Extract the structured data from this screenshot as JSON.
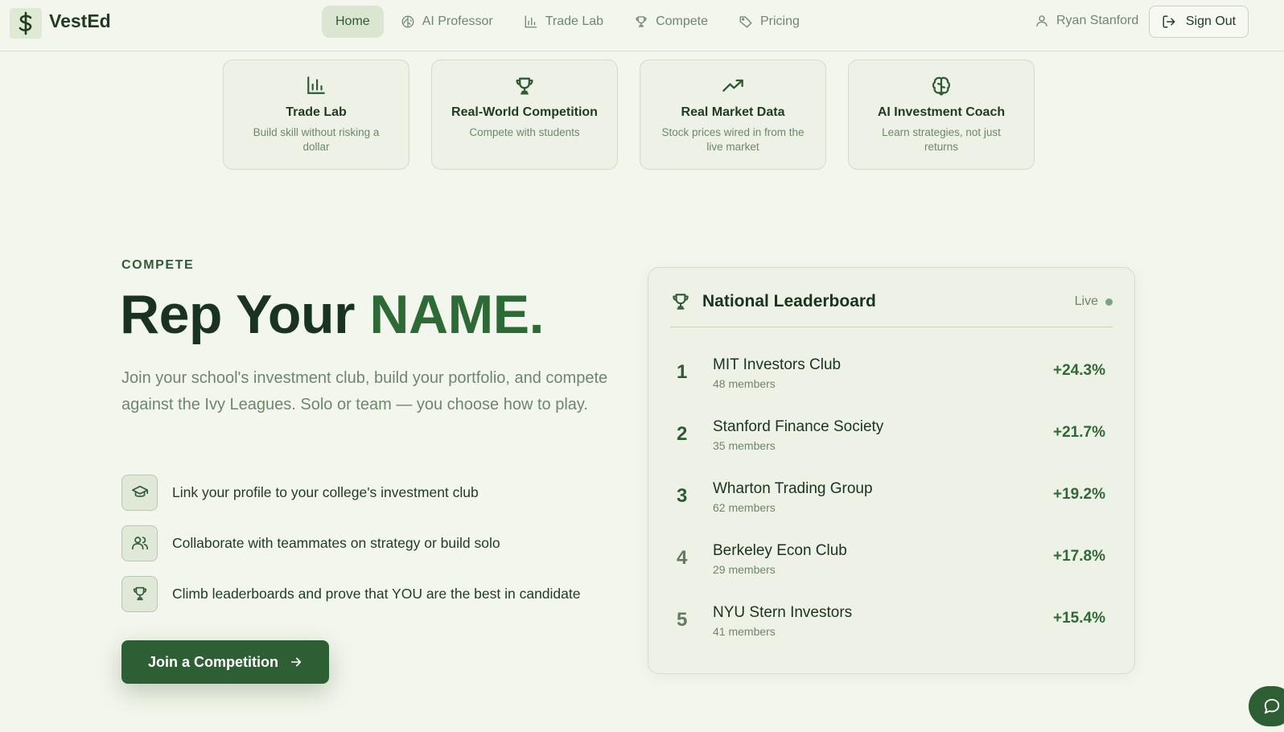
{
  "brand": {
    "name": "VestEd",
    "logo_icon": "dollar-serpent-icon"
  },
  "nav": {
    "items": [
      {
        "label": "Home",
        "icon": "home",
        "active": true
      },
      {
        "label": "AI Professor",
        "icon": "brain-icon",
        "active": false
      },
      {
        "label": "Trade Lab",
        "icon": "bar-chart-icon",
        "active": false
      },
      {
        "label": "Compete",
        "icon": "trophy-icon",
        "active": false
      },
      {
        "label": "Pricing",
        "icon": "tag-icon",
        "active": false
      }
    ]
  },
  "user": {
    "name": "Ryan Stanford",
    "icon": "user-icon"
  },
  "signout": {
    "label": "Sign Out",
    "icon": "sign-out-icon"
  },
  "features": [
    {
      "title": "Trade Lab",
      "desc": "Build skill without risking a dollar",
      "icon": "bar-chart-icon"
    },
    {
      "title": "Real-World Competition",
      "desc": "Compete with students",
      "icon": "trophy-icon"
    },
    {
      "title": "Real Market Data",
      "desc": "Stock prices wired in from the live market",
      "icon": "trend-up-icon"
    },
    {
      "title": "AI Investment Coach",
      "desc": "Learn strategies, not just returns",
      "icon": "brain-icon"
    }
  ],
  "compete": {
    "eyebrow": "COMPETE",
    "title_start": "Rep Your ",
    "title_accent": "NAME.",
    "description": "Join your school's investment club, build your portfolio, and compete against the Ivy Leagues. Solo or team — you choose how to play.",
    "bullets": [
      {
        "text": "Link your profile to your college's investment club",
        "icon": "graduation-cap-icon"
      },
      {
        "text": "Collaborate with teammates on strategy or build solo",
        "icon": "users-icon"
      },
      {
        "text": "Climb leaderboards and prove that YOU are the best in candidate",
        "icon": "trophy-icon"
      }
    ],
    "cta_label": "Join a Competition"
  },
  "leaderboard": {
    "title": "National Leaderboard",
    "status": "Live",
    "rows": [
      {
        "rank": "1",
        "club": "MIT Investors Club",
        "members": "48 members",
        "return": "+24.3%"
      },
      {
        "rank": "2",
        "club": "Stanford Finance Society",
        "members": "35 members",
        "return": "+21.7%"
      },
      {
        "rank": "3",
        "club": "Wharton Trading Group",
        "members": "62 members",
        "return": "+19.2%"
      },
      {
        "rank": "4",
        "club": "Berkeley Econ Club",
        "members": "29 members",
        "return": "+17.8%"
      },
      {
        "rank": "5",
        "club": "NYU Stern Investors",
        "members": "41 members",
        "return": "+15.4%"
      }
    ]
  },
  "colors": {
    "accent": "#2e5e33",
    "background": "#f3f6ec",
    "muted": "#6e8670"
  }
}
